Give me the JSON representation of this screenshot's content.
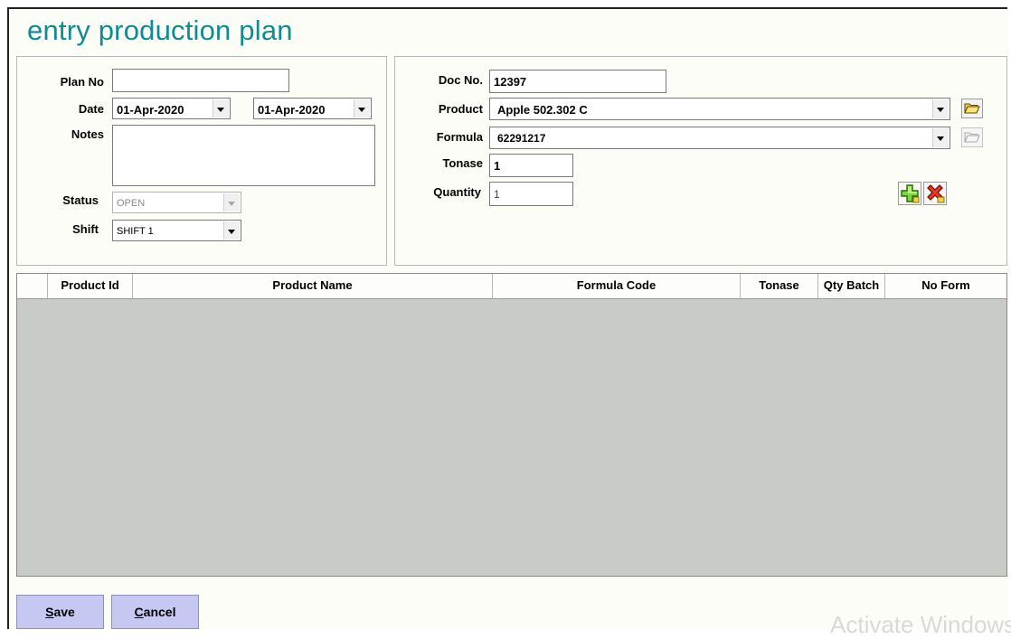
{
  "title": "entry production plan",
  "left_panel": {
    "plan_no_label": "Plan No",
    "plan_no_value": "",
    "date_label": "Date",
    "date_from": "01-Apr-2020",
    "date_to": "01-Apr-2020",
    "notes_label": "Notes",
    "notes_value": "",
    "status_label": "Status",
    "status_value": "OPEN",
    "shift_label": "Shift",
    "shift_value": "SHIFT 1"
  },
  "right_panel": {
    "doc_no_label": "Doc No.",
    "doc_no_value": "12397",
    "product_label": "Product",
    "product_value": "Apple 502.302 C",
    "formula_label": "Formula",
    "formula_value": "62291217",
    "tonase_label": "Tonase",
    "tonase_value": "1",
    "quantity_label": "Quantity",
    "quantity_value": "1"
  },
  "grid": {
    "columns": [
      "",
      "Product Id",
      "Product Name",
      "Formula Code",
      "Tonase",
      "Qty Batch",
      "No Form"
    ]
  },
  "footer": {
    "save_mnemonic": "S",
    "save_rest": "ave",
    "cancel_mnemonic": "C",
    "cancel_rest": "ancel"
  },
  "watermark": "Activate Windows",
  "icons": {
    "folder_open": "folder-open-icon",
    "folder_disabled": "folder-icon",
    "add": "add-row-icon",
    "delete": "delete-row-icon"
  }
}
